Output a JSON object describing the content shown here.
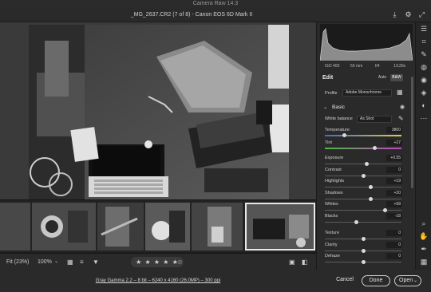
{
  "app": {
    "title": "Camera Raw 14.3"
  },
  "file": {
    "name": "_MG_2637.CR2 (7 of 8)  -  Canon EOS 6D Mark II"
  },
  "meta": {
    "iso": "ISO 400",
    "focal": "50 mm",
    "aperture": "f/4",
    "shutter": "1/120s"
  },
  "edit": {
    "label": "Edit",
    "auto": "Auto",
    "bw": "B&W"
  },
  "profile": {
    "label": "Profile",
    "value": "Adobe Monochrome"
  },
  "basic": {
    "label": "Basic",
    "white_balance_label": "White balance",
    "white_balance_value": "As Shot",
    "temperature_label": "Temperature",
    "temperature_value": "3800",
    "tint_label": "Tint",
    "tint_value": "+27",
    "sliders": [
      {
        "label": "Exposure",
        "value": "+0.55",
        "pos": 0.55
      },
      {
        "label": "Contrast",
        "value": "0",
        "pos": 0.5
      },
      {
        "label": "Highlights",
        "value": "+19",
        "pos": 0.6
      },
      {
        "label": "Shadows",
        "value": "+20",
        "pos": 0.6
      },
      {
        "label": "Whites",
        "value": "+58",
        "pos": 0.79
      },
      {
        "label": "Blacks",
        "value": "-18",
        "pos": 0.41
      }
    ],
    "presence": [
      {
        "label": "Texture",
        "value": "0",
        "pos": 0.5
      },
      {
        "label": "Clarity",
        "value": "0",
        "pos": 0.5
      },
      {
        "label": "Dehaze",
        "value": "0",
        "pos": 0.5
      }
    ]
  },
  "bottom": {
    "zoom_fit": "Fit (23%)",
    "zoom_pct": "100%",
    "stars": "★ ★ ★ ★ ★"
  },
  "footer": {
    "info": "Gray Gamma 2.2 – 8 bit – 6240 x 4160 (26.0MP) – 300 ppi",
    "cancel": "Cancel",
    "done": "Done",
    "open": "Open"
  },
  "colors": {
    "accent": "#1473e6",
    "panel": "#2a2a2a",
    "canvas": "#3a3a3a"
  }
}
